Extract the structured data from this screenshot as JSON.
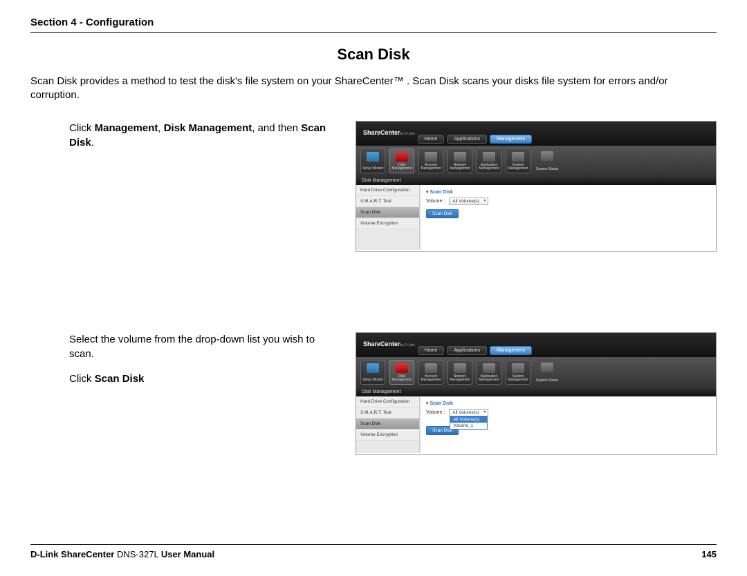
{
  "header": {
    "section_label": "Section 4 - Configuration"
  },
  "title": "Scan Disk",
  "intro": "Scan Disk provides a method to test the disk's file system on your ShareCenter™ . Scan Disk scans your disks file system for errors and/or corruption.",
  "step1": {
    "prefix": "Click ",
    "b1": "Management",
    "sep1": ", ",
    "b2": "Disk Management",
    "sep2": ", and then ",
    "b3": "Scan Disk",
    "suffix": "."
  },
  "step2": {
    "line1": "Select the volume from the drop-down list you wish to scan.",
    "line2_prefix": "Click ",
    "line2_bold": "Scan Disk"
  },
  "screenshot": {
    "brand": "ShareCenter",
    "brand_sub": "by D-Link",
    "tabs": {
      "home": "Home",
      "applications": "Applications",
      "management": "Management"
    },
    "icons": {
      "setup": "Setup Wizard",
      "disk": "Disk Management",
      "account": "Account Management",
      "network": "Network Management",
      "application": "Application Management",
      "system": "System Management",
      "status": "System Status"
    },
    "section_bar": "Disk Management",
    "sidebar": {
      "hdd": "Hard Drive Configuration",
      "smart": "S.M.A.R.T. Test",
      "scan": "Scan Disk",
      "enc": "Volume Encryption"
    },
    "panel": {
      "title": "▾ Scan Disk",
      "volume_label": "Volume :",
      "volume_value": "All Volume(s)",
      "dropdown_opt0": "All Volume(s)",
      "dropdown_opt1": "Volume_1",
      "button": "Scan Disk"
    }
  },
  "footer": {
    "brand_bold": "D-Link ShareCenter",
    "model": " DNS-327L ",
    "suffix_bold": "User Manual",
    "page": "145"
  }
}
